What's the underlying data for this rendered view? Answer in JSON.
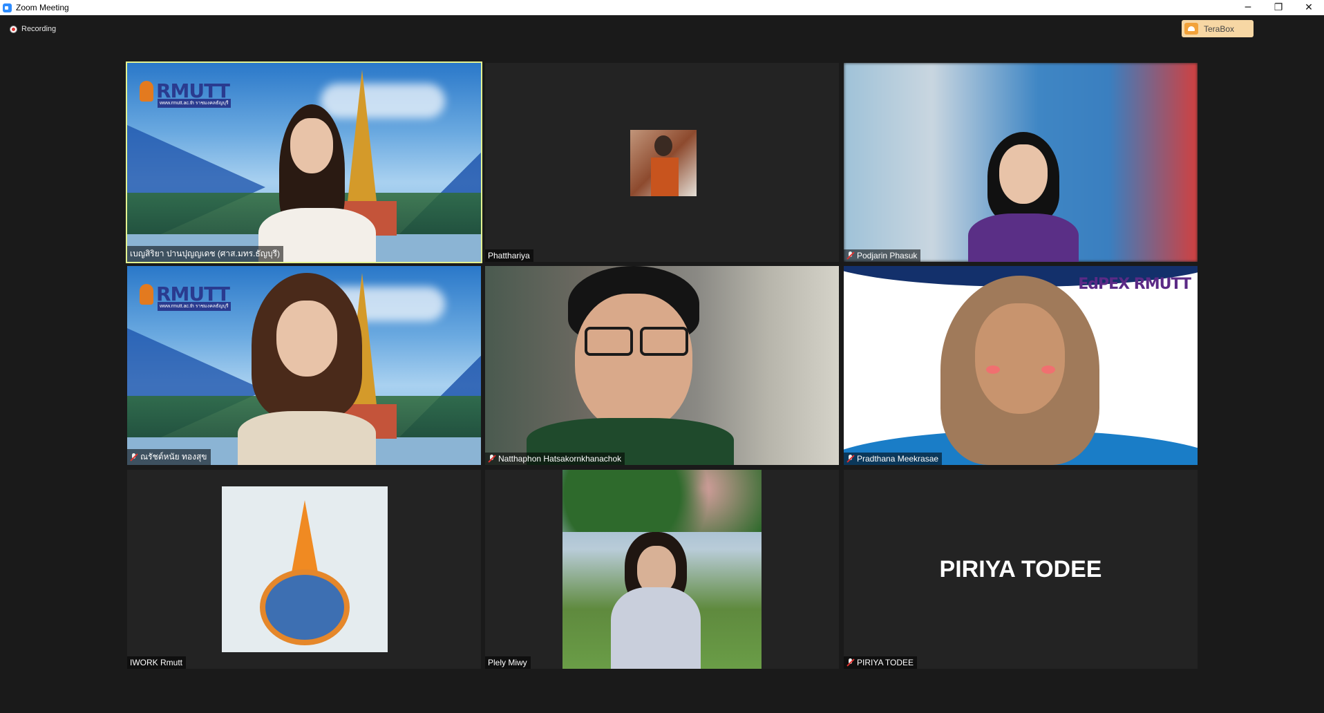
{
  "window": {
    "title": "Zoom Meeting",
    "controls": {
      "minimize": "─",
      "restore": "❐",
      "close": "✕"
    }
  },
  "recording": {
    "label": "Recording"
  },
  "terabox": {
    "label": "TeraBox"
  },
  "participants": [
    {
      "name": "เบญสิริยา ปานปุญญเดช (ศาส.มทร.ธัญบุรี)",
      "muted": false,
      "active_speaker": true,
      "logo_text": "RMUTT",
      "logo_sub": "www.rmutt.ac.th  ราชมงคลธัญบุรี"
    },
    {
      "name": "Phatthariya",
      "muted": false,
      "active_speaker": false
    },
    {
      "name": "Podjarin Phasuk",
      "muted": true,
      "active_speaker": false
    },
    {
      "name": "ณรัชต์หนัย ทองสุข",
      "muted": true,
      "active_speaker": false,
      "logo_text": "RMUTT",
      "logo_sub": "www.rmutt.ac.th  ราชมงคลธัญบุรี"
    },
    {
      "name": "Natthaphon Hatsakornkhanachok",
      "muted": true,
      "active_speaker": false
    },
    {
      "name": "Pradthana Meekrasae",
      "muted": true,
      "active_speaker": false,
      "brand_text": "EdPEX RMUTT"
    },
    {
      "name": "IWORK Rmutt",
      "muted": false,
      "active_speaker": false
    },
    {
      "name": "Plely Miwy",
      "muted": false,
      "active_speaker": false
    },
    {
      "name": "PIRIYA TODEE",
      "muted": true,
      "active_speaker": false,
      "display_name": "PIRIYA TODEE"
    }
  ]
}
